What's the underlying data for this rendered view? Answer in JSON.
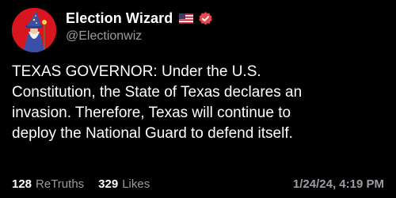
{
  "account": {
    "display_name": "Election Wizard",
    "handle": "@Electionwiz",
    "avatar_icon": "wizard-avatar-icon",
    "flag_icon": "us-flag-icon",
    "verified_icon": "verified-badge-icon",
    "verified_color": "#e5484d"
  },
  "post": {
    "text": "TEXAS GOVERNOR: Under the U.S.\nConstitution, the State of Texas declares an\ninvasion. Therefore, Texas will continue to\ndeploy the National Guard to defend itself."
  },
  "stats": {
    "retruths_count": "128",
    "retruths_label": "ReTruths",
    "likes_count": "329",
    "likes_label": "Likes"
  },
  "timestamp": "1/24/24, 4:19 PM"
}
